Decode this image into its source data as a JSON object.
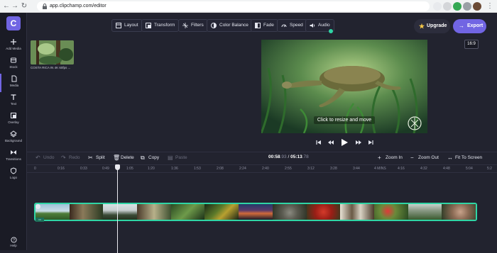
{
  "browser": {
    "url": "app.clipchamp.com/editor"
  },
  "sidebar": {
    "logo": "C",
    "items": [
      {
        "label": "Add Media",
        "icon": "plus-icon"
      },
      {
        "label": "Stock",
        "icon": "stock-icon"
      },
      {
        "label": "Media",
        "icon": "media-icon"
      },
      {
        "label": "Text",
        "icon": "text-icon"
      },
      {
        "label": "Overlay",
        "icon": "overlay-icon"
      },
      {
        "label": "Background",
        "icon": "background-icon"
      },
      {
        "label": "Transitions",
        "icon": "transitions-icon"
      },
      {
        "label": "Logo",
        "icon": "logo-icon"
      }
    ],
    "help": "Help"
  },
  "toolbar": {
    "items": [
      {
        "label": "Layout",
        "icon": "layout-icon"
      },
      {
        "label": "Transform",
        "icon": "transform-icon"
      },
      {
        "label": "Filters",
        "icon": "filters-icon"
      },
      {
        "label": "Color Balance",
        "icon": "color-balance-icon"
      },
      {
        "label": "Fade",
        "icon": "fade-icon"
      },
      {
        "label": "Speed",
        "icon": "speed-icon"
      },
      {
        "label": "Audio",
        "icon": "audio-icon"
      }
    ],
    "upgrade": "Upgrade",
    "export": "Export"
  },
  "preview": {
    "aspect_ratio": "16:9",
    "hint": "Click to resize and move"
  },
  "media": {
    "file_name": "COSTA RICA IN 4K 60fps ..."
  },
  "timeline": {
    "undo": "Undo",
    "redo": "Redo",
    "split": "Split",
    "delete": "Delete",
    "copy": "Copy",
    "paste": "Paste",
    "current_time": "00:58",
    "current_frac": ".93",
    "separator": " / ",
    "total_time": "05:13",
    "total_frac": ".78",
    "zoom_in": "Zoom In",
    "zoom_out": "Zoom Out",
    "fit": "Fit To Screen",
    "ruler": [
      "0",
      "0:16",
      "0:33",
      "0:49",
      "1:05",
      "1:20",
      "1:36",
      "1:53",
      "2:08",
      "2:24",
      "2:40",
      "2:55",
      "3:12",
      "3:28",
      "3:44",
      "4 MINS",
      "4:16",
      "4:32",
      "4:48",
      "5:04",
      "5:2"
    ],
    "track_badge": "▭"
  },
  "colors": {
    "accent": "#7165e3",
    "track_border": "#2fd5a5",
    "background": "#22232f"
  }
}
